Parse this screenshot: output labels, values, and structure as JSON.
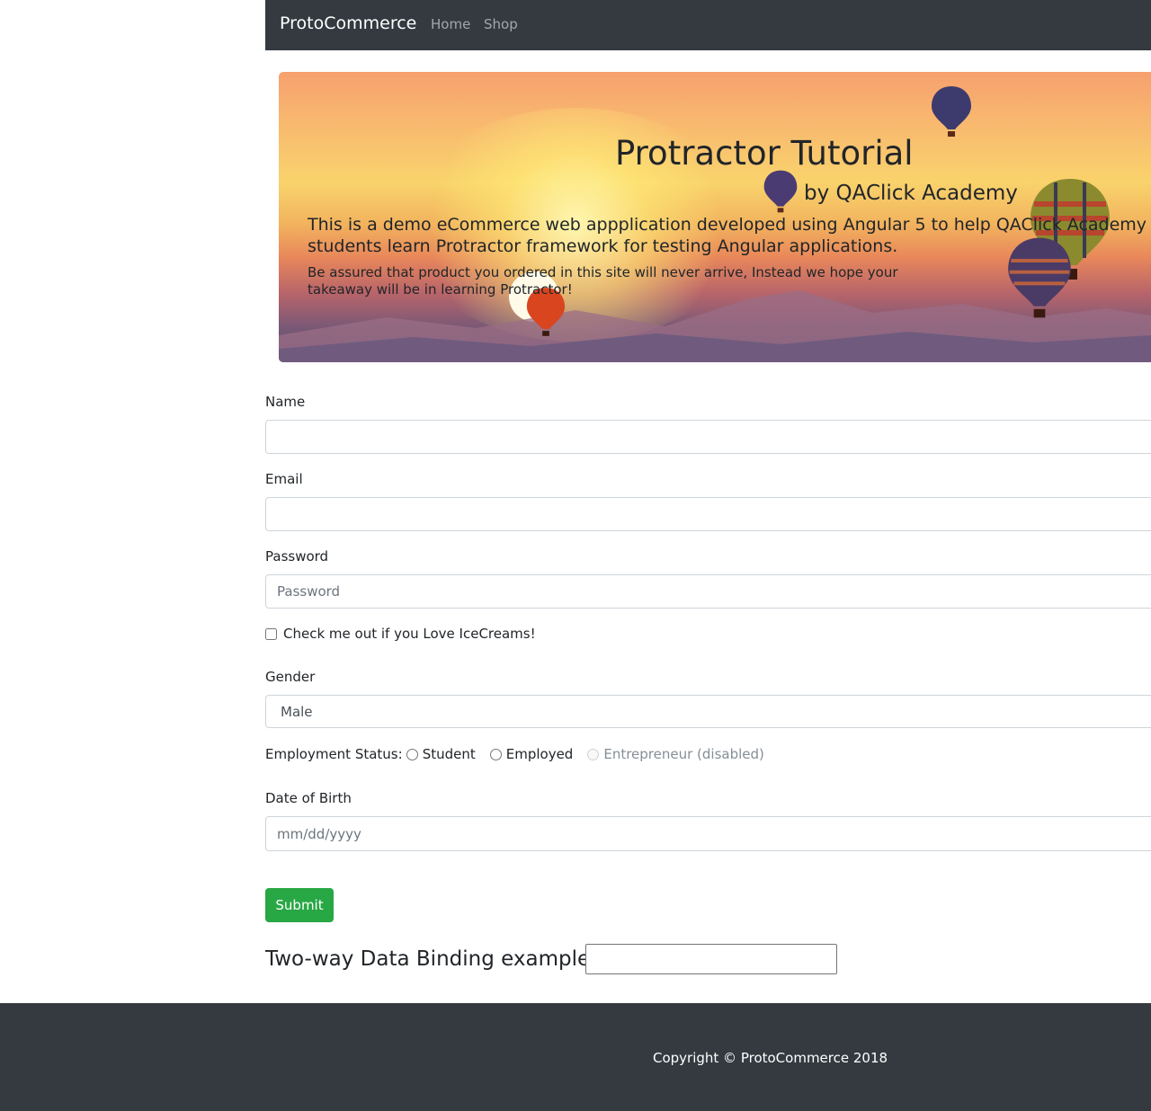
{
  "navbar": {
    "brand": "ProtoCommerce",
    "links": [
      {
        "label": "Home"
      },
      {
        "label": "Shop"
      }
    ]
  },
  "hero": {
    "title": "Protractor Tutorial",
    "subtitle": "by QAClick Academy",
    "description": "This is a demo eCommerce web appplication developed using Angular 5 to help QAClick Academy students learn Protractor framework for testing Angular applications.",
    "note": "Be assured that product you ordered in this site will never arrive, Instead we hope your takeaway will be in learning Protractor!"
  },
  "form": {
    "name_label": "Name",
    "name_value": "",
    "email_label": "Email",
    "email_value": "",
    "password_label": "Password",
    "password_placeholder": "Password",
    "checkbox_label": "Check me out if you Love IceCreams!",
    "checkbox_checked": false,
    "gender_label": "Gender",
    "gender_selected": "Male",
    "employment_label": "Employment Status:",
    "employment_options": [
      {
        "label": "Student",
        "disabled": false
      },
      {
        "label": "Employed",
        "disabled": false
      },
      {
        "label": "Entrepreneur (disabled)",
        "disabled": true
      }
    ],
    "dob_label": "Date of Birth",
    "dob_placeholder": "mm/dd/yyyy",
    "submit_label": "Submit"
  },
  "binding": {
    "label": "Two-way Data Binding example:",
    "value": ""
  },
  "footer": {
    "copyright": "Copyright © ProtoCommerce 2018"
  },
  "colors": {
    "navbar_bg": "#343a40",
    "submit_bg": "#28a745",
    "footer_bg": "#343a40"
  }
}
